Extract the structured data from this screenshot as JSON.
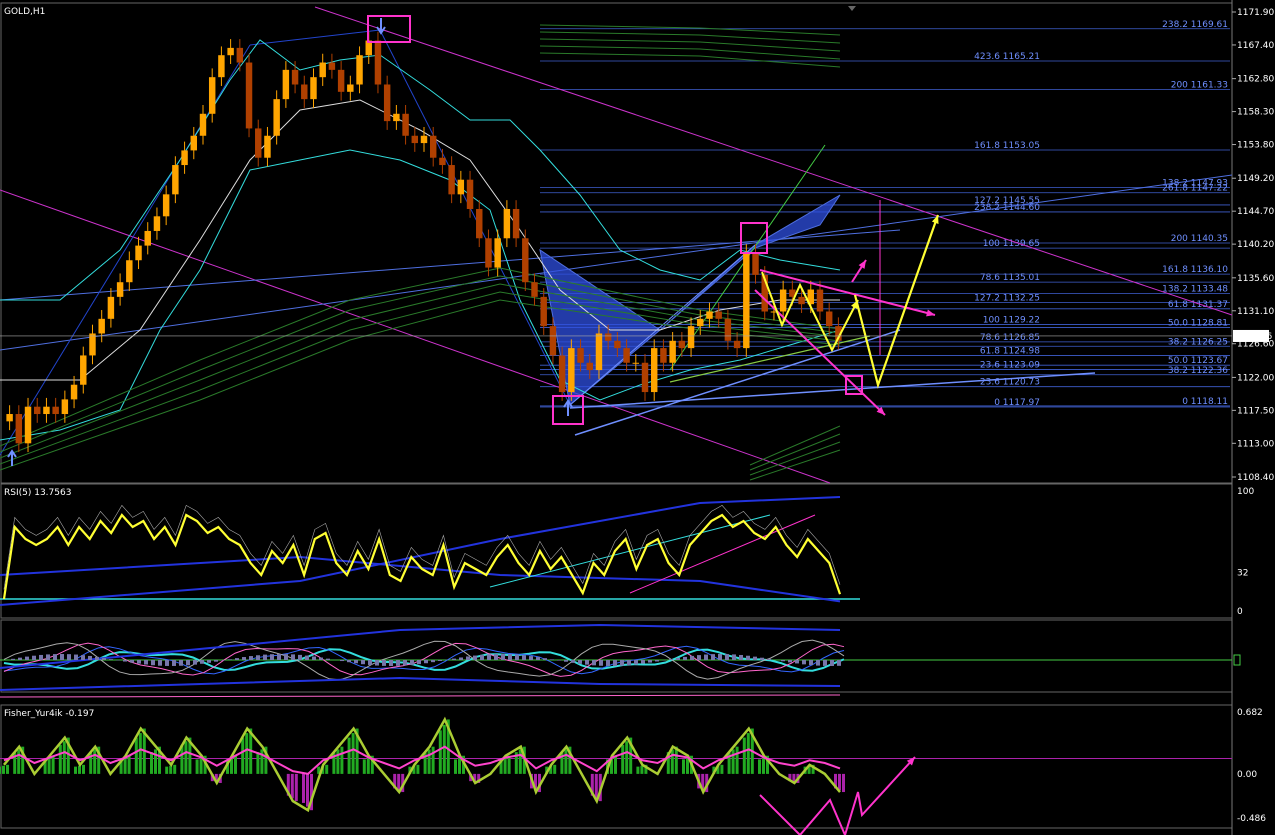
{
  "window": {
    "symbol_label": "GOLD,H1",
    "current_price_tag": "1127.66"
  },
  "colors": {
    "background": "#000000",
    "candle_up": "#ffa500",
    "candle_down": "#b04000",
    "fib_line": "#3f5fd0",
    "pattern_fill": "#2f4fe0",
    "marker": "#ff33cc",
    "arrow_yellow": "#ffff33",
    "green": "#44cc44",
    "cyan": "#33dddd",
    "rsi_line": "#ffff33"
  },
  "chart_data": [
    {
      "type": "line",
      "title": "GOLD,H1",
      "y_ticks": [
        "1171.90",
        "1167.40",
        "1162.80",
        "1158.30",
        "1153.80",
        "1149.20",
        "1144.70",
        "1140.20",
        "1135.60",
        "1131.10",
        "1126.60",
        "1122.00",
        "1117.50",
        "1113.00",
        "1108.40"
      ],
      "ylim": [
        1108.4,
        1171.9
      ],
      "x_tick_labels": [],
      "series": [
        {
          "values": [
            1117,
            1113,
            1118,
            1117,
            1118,
            1117,
            1119,
            1121,
            1125,
            1128,
            1130,
            1133,
            1135,
            1138,
            1140,
            1142,
            1144,
            1147,
            1151,
            1153,
            1155,
            1158,
            1163,
            1166,
            1167,
            1165,
            1156,
            1152,
            1155,
            1160,
            1164,
            1162,
            1160,
            1163,
            1165,
            1164,
            1161,
            1162,
            1166,
            1168,
            1162,
            1157,
            1158,
            1155,
            1154,
            1155,
            1152,
            1151,
            1147,
            1149,
            1145,
            1141,
            1137,
            1141,
            1145,
            1141,
            1135,
            1133,
            1129,
            1125,
            1120,
            1126,
            1124,
            1123,
            1128,
            1127,
            1126,
            1124,
            1124,
            1120,
            1126,
            1124,
            1127,
            1126,
            1129,
            1130,
            1131,
            1130,
            1127,
            1126,
            1139,
            1136,
            1131,
            1131,
            1134,
            1133,
            1132,
            1134,
            1131,
            1129,
            1127
          ]
        }
      ],
      "fib_right": [
        {
          "label": "238.2 1169.61",
          "price": 1169.61
        },
        {
          "label": "423.6 1165.21",
          "price": 1165.21
        },
        {
          "label": "200 1161.33",
          "price": 1161.33
        },
        {
          "label": "161.8 1153.05",
          "price": 1153.05
        },
        {
          "label": "138.2 1147.93",
          "price": 1147.93
        },
        {
          "label": "127.2 1145.55",
          "price": 1145.55
        },
        {
          "label": "261.8 1147.22",
          "price": 1147.22
        },
        {
          "label": "238.2 1144.60",
          "price": 1144.6
        },
        {
          "label": "200 1140.35",
          "price": 1140.35
        },
        {
          "label": "100 1139.65",
          "price": 1139.65
        },
        {
          "label": "161.8 1136.10",
          "price": 1136.1
        },
        {
          "label": "78.6 1135.01",
          "price": 1135.01
        },
        {
          "label": "138.2 1133.48",
          "price": 1133.48
        },
        {
          "label": "127.2 1132.25",
          "price": 1132.25
        },
        {
          "label": "61.8 1131.37",
          "price": 1131.37
        },
        {
          "label": "100 1129.22",
          "price": 1129.22
        },
        {
          "label": "50.0 1128.81",
          "price": 1128.81
        },
        {
          "label": "78.6 1126.85",
          "price": 1126.85
        },
        {
          "label": "38.2 1126.25",
          "price": 1126.25
        },
        {
          "label": "61.8 1124.98",
          "price": 1124.98
        },
        {
          "label": "50.0 1123.67",
          "price": 1123.67
        },
        {
          "label": "23.6 1123.09",
          "price": 1123.09
        },
        {
          "label": "38.2 1122.36",
          "price": 1122.36
        },
        {
          "label": "23.6 1120.73",
          "price": 1120.73
        },
        {
          "label": "0 1118.11",
          "price": 1118.11
        },
        {
          "label": "0 1117.97",
          "price": 1117.97
        }
      ]
    },
    {
      "type": "line",
      "title": "RSI(5) 13.7563",
      "ylim": [
        0,
        100
      ],
      "y_ticks": [
        "100",
        "32",
        "0"
      ],
      "series": [
        {
          "name": "RSI(5)",
          "values": [
            10,
            70,
            60,
            55,
            60,
            70,
            55,
            70,
            60,
            75,
            65,
            80,
            70,
            75,
            60,
            70,
            55,
            80,
            75,
            65,
            70,
            60,
            55,
            40,
            30,
            50,
            40,
            55,
            30,
            60,
            65,
            40,
            30,
            50,
            35,
            60,
            30,
            25,
            45,
            35,
            30,
            55,
            20,
            40,
            35,
            30,
            45,
            55,
            40,
            30,
            50,
            35,
            45,
            30,
            15,
            40,
            30,
            50,
            60,
            35,
            55,
            60,
            40,
            30,
            55,
            65,
            75,
            80,
            70,
            75,
            65,
            60,
            70,
            55,
            45,
            60,
            50,
            40,
            14
          ]
        }
      ]
    },
    {
      "type": "line",
      "title": "Fisher_Yur4ik -0.197",
      "ylim": [
        -0.486,
        0.682
      ],
      "y_ticks": [
        "0.682",
        "0.00",
        "-0.486"
      ],
      "series": [
        {
          "name": "Fisher_Yur4ik",
          "values": [
            0.1,
            0.3,
            0.0,
            0.2,
            0.4,
            0.1,
            0.3,
            0.0,
            0.2,
            0.5,
            0.3,
            0.1,
            0.4,
            0.2,
            -0.1,
            0.2,
            0.5,
            0.3,
            0.0,
            -0.3,
            -0.4,
            0.1,
            0.3,
            0.5,
            0.2,
            0.0,
            -0.2,
            0.1,
            0.3,
            0.6,
            0.2,
            -0.1,
            0.0,
            0.2,
            0.3,
            -0.2,
            0.1,
            0.3,
            0.0,
            -0.3,
            0.2,
            0.4,
            0.1,
            0.0,
            0.3,
            0.2,
            -0.2,
            0.1,
            0.3,
            0.5,
            0.2,
            0.0,
            -0.1,
            0.1,
            0.0,
            -0.2
          ]
        }
      ]
    }
  ]
}
